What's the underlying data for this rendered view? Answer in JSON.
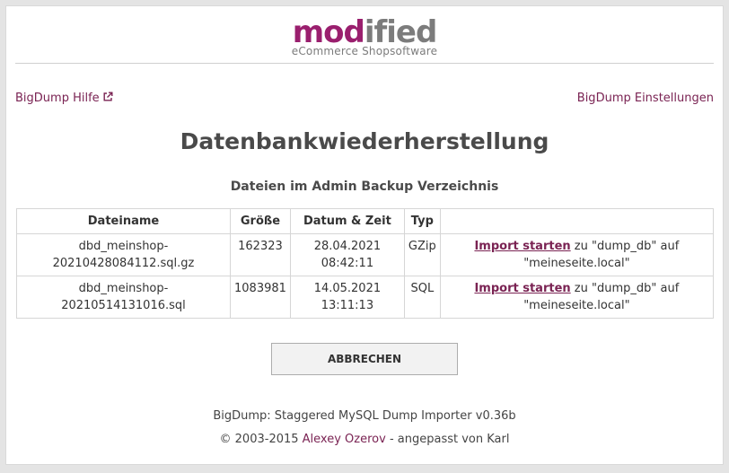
{
  "logo": {
    "word_part1": "mod",
    "word_part2": "ified",
    "tagline": "eCommerce Shopsoftware"
  },
  "links": {
    "help": "BigDump Hilfe",
    "settings": "BigDump Einstellungen"
  },
  "page": {
    "title": "Datenbankwiederherstellung",
    "subtitle": "Dateien im Admin Backup Verzeichnis"
  },
  "table": {
    "headers": [
      "Dateiname",
      "Größe",
      "Datum & Zeit",
      "Typ",
      ""
    ],
    "rows": [
      {
        "filename_line1": "dbd_meinshop-",
        "filename_line2": "20210428084112.sql.gz",
        "size": "162323",
        "date": "28.04.2021",
        "time": "08:42:11",
        "type": "GZip",
        "action_link": "Import starten",
        "action_text1": " zu \"dump_db\" auf",
        "action_text2": "\"meineseite.local\""
      },
      {
        "filename": "dbd_meinshop-20210514131016.sql",
        "size": "1083981",
        "date": "14.05.2021",
        "time": "13:11:13",
        "type": "SQL",
        "action_link": "Import starten",
        "action_text1": " zu \"dump_db\" auf",
        "action_text2": "\"meineseite.local\""
      }
    ]
  },
  "buttons": {
    "cancel": "ABBRECHEN"
  },
  "footer": {
    "line1": "BigDump: Staggered MySQL Dump Importer v0.36b",
    "copyright": "© 2003-2015 ",
    "author": "Alexey Ozerov",
    "suffix": " - angepasst von Karl"
  },
  "colors": {
    "brand": "#9a1f6e",
    "link": "#7a2353",
    "logo_gray": "#7c7c7c"
  },
  "icons": {
    "help_link": "external-link-icon"
  }
}
